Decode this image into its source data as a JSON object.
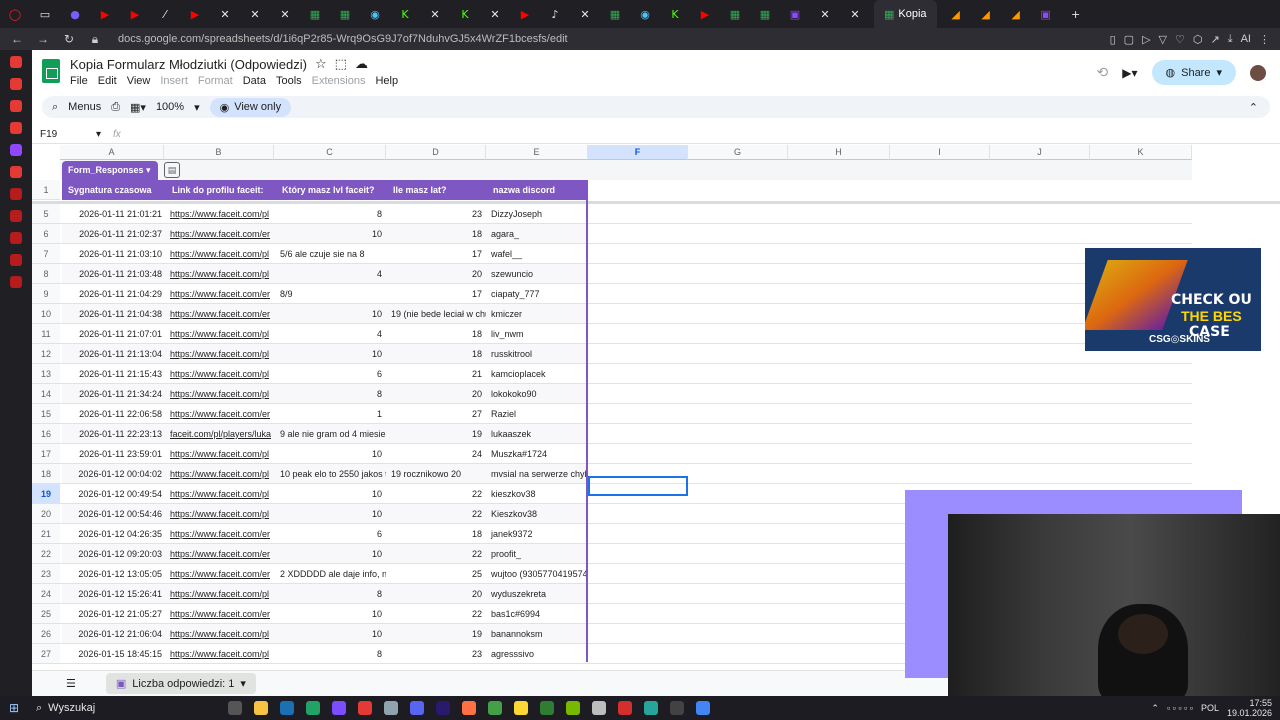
{
  "browser": {
    "active_tab_label": "Kopia",
    "url": "docs.google.com/spreadsheets/d/1i6qP2r85-Wrq9OsG9J7of7NduhvGJ5x4WrZF1bcesfs/edit",
    "ai_label": "AI"
  },
  "sheets": {
    "title": "Kopia Formularz Młodziutki (Odpowiedzi)",
    "menu": [
      "File",
      "Edit",
      "View",
      "Insert",
      "Format",
      "Data",
      "Tools",
      "Extensions",
      "Help"
    ],
    "menu_disabled": [
      "Insert",
      "Format",
      "Extensions"
    ],
    "share_label": "Share",
    "toolbar": {
      "menus_label": "Menus",
      "zoom": "100%",
      "view_only_label": "View only"
    },
    "name_box": "F19",
    "fx_label": "fx",
    "columns": [
      "A",
      "B",
      "C",
      "D",
      "E",
      "F",
      "G",
      "H",
      "I",
      "J",
      "K"
    ],
    "selected_column": "F",
    "table_name": "Form_Responses",
    "header_row_number": "1",
    "headers": [
      "Sygnatura czasowa",
      "Link do profilu faceit:",
      "Który masz lvl faceit?",
      "Ile masz lat?",
      "nazwa discord"
    ],
    "rows": [
      {
        "n": "5",
        "ts": "2026-01-11 21:01:21",
        "link": "https://www.faceit.com/pl",
        "lvl": "8",
        "age": "23",
        "discord": "DizzyJoseph"
      },
      {
        "n": "6",
        "ts": "2026-01-11 21:02:37",
        "link": "https://www.faceit.com/er",
        "lvl": "10",
        "age": "18",
        "discord": "agara_"
      },
      {
        "n": "7",
        "ts": "2026-01-11 21:03:10",
        "link": "https://www.faceit.com/pl",
        "lvl": "5/6 ale czuje sie na 8",
        "age": "17",
        "discord": "wafel__"
      },
      {
        "n": "8",
        "ts": "2026-01-11 21:03:48",
        "link": "https://www.faceit.com/pl",
        "lvl": "4",
        "age": "20",
        "discord": "szewuncio"
      },
      {
        "n": "9",
        "ts": "2026-01-11 21:04:29",
        "link": "https://www.faceit.com/er",
        "lvl": "8/9",
        "age": "17",
        "discord": "ciapaty_777"
      },
      {
        "n": "10",
        "ts": "2026-01-11 21:04:38",
        "link": "https://www.faceit.com/er",
        "lvl": "10",
        "age": "19 (nie bede leciał w chu",
        "discord": "kmiczer"
      },
      {
        "n": "11",
        "ts": "2026-01-11 21:07:01",
        "link": "https://www.faceit.com/pl",
        "lvl": "4",
        "age": "18",
        "discord": "liv_nwm"
      },
      {
        "n": "12",
        "ts": "2026-01-11 21:13:04",
        "link": "https://www.faceit.com/pl",
        "lvl": "10",
        "age": "18",
        "discord": "russkitrool"
      },
      {
        "n": "13",
        "ts": "2026-01-11 21:15:43",
        "link": "https://www.faceit.com/pl",
        "lvl": "6",
        "age": "21",
        "discord": "kamcioplacek"
      },
      {
        "n": "14",
        "ts": "2026-01-11 21:34:24",
        "link": "https://www.faceit.com/pl",
        "lvl": "8",
        "age": "20",
        "discord": "lokokoko90"
      },
      {
        "n": "15",
        "ts": "2026-01-11 22:06:58",
        "link": "https://www.faceit.com/er",
        "lvl": "1",
        "age": "27",
        "discord": "Raziel"
      },
      {
        "n": "16",
        "ts": "2026-01-11 22:23:13",
        "link": "faceit.com/pl/players/luka",
        "lvl": "9 ale nie gram od 4 miesie",
        "age": "19",
        "discord": "lukaaszek"
      },
      {
        "n": "17",
        "ts": "2026-01-11 23:59:01",
        "link": "https://www.faceit.com/pl",
        "lvl": "10",
        "age": "24",
        "discord": "Muszka#1724"
      },
      {
        "n": "18",
        "ts": "2026-01-12 00:04:02",
        "link": "https://www.faceit.com/pl",
        "lvl": "10 peak elo to 2550 jakos t",
        "age": "19 rocznikowo 20",
        "discord": "mvsial na serwerze chyb"
      },
      {
        "n": "19",
        "ts": "2026-01-12 00:49:54",
        "link": "https://www.faceit.com/pl",
        "lvl": "10",
        "age": "22",
        "discord": "kieszkov38"
      },
      {
        "n": "20",
        "ts": "2026-01-12 00:54:46",
        "link": "https://www.faceit.com/pl",
        "lvl": "10",
        "age": "22",
        "discord": "Kieszkov38"
      },
      {
        "n": "21",
        "ts": "2026-01-12 04:26:35",
        "link": "https://www.faceit.com/er",
        "lvl": "6",
        "age": "18",
        "discord": "janek9372"
      },
      {
        "n": "22",
        "ts": "2026-01-12 09:20:03",
        "link": "https://www.faceit.com/er",
        "lvl": "10",
        "age": "22",
        "discord": "proofit_"
      },
      {
        "n": "23",
        "ts": "2026-01-12 13:05:05",
        "link": "https://www.faceit.com/er",
        "lvl": "2 XDDDDD ale daje info, nie",
        "age": "25",
        "discord": "wujtoo (93057704195747"
      },
      {
        "n": "24",
        "ts": "2026-01-12 15:26:41",
        "link": "https://www.faceit.com/pl",
        "lvl": "8",
        "age": "20",
        "discord": "wyduszekreta"
      },
      {
        "n": "25",
        "ts": "2026-01-12 21:05:27",
        "link": "https://www.faceit.com/er",
        "lvl": "10",
        "age": "22",
        "discord": "bas1c#6994"
      },
      {
        "n": "26",
        "ts": "2026-01-12 21:06:04",
        "link": "https://www.faceit.com/pl",
        "lvl": "10",
        "age": "19",
        "discord": "banannoksm"
      },
      {
        "n": "27",
        "ts": "2026-01-15 18:45:15",
        "link": "https://www.faceit.com/pl",
        "lvl": "8",
        "age": "23",
        "discord": "agresssivo"
      }
    ],
    "selected_row": "19",
    "sheet_tab_label": "Liczba odpowiedzi: 1"
  },
  "ad": {
    "line1": "CHECK OU",
    "line2": "THE BES",
    "line3": "CASE",
    "brand": "CSG◎SKINS"
  },
  "taskbar": {
    "search_placeholder": "Wyszukaj",
    "lang": "POL",
    "time": "17:55",
    "date": "19.01.2026"
  },
  "colors": {
    "table_accent": "#7e57c2",
    "selection": "#1a73e8",
    "share_bg": "#c2e7ff",
    "cam_border": "#9b8cff"
  }
}
